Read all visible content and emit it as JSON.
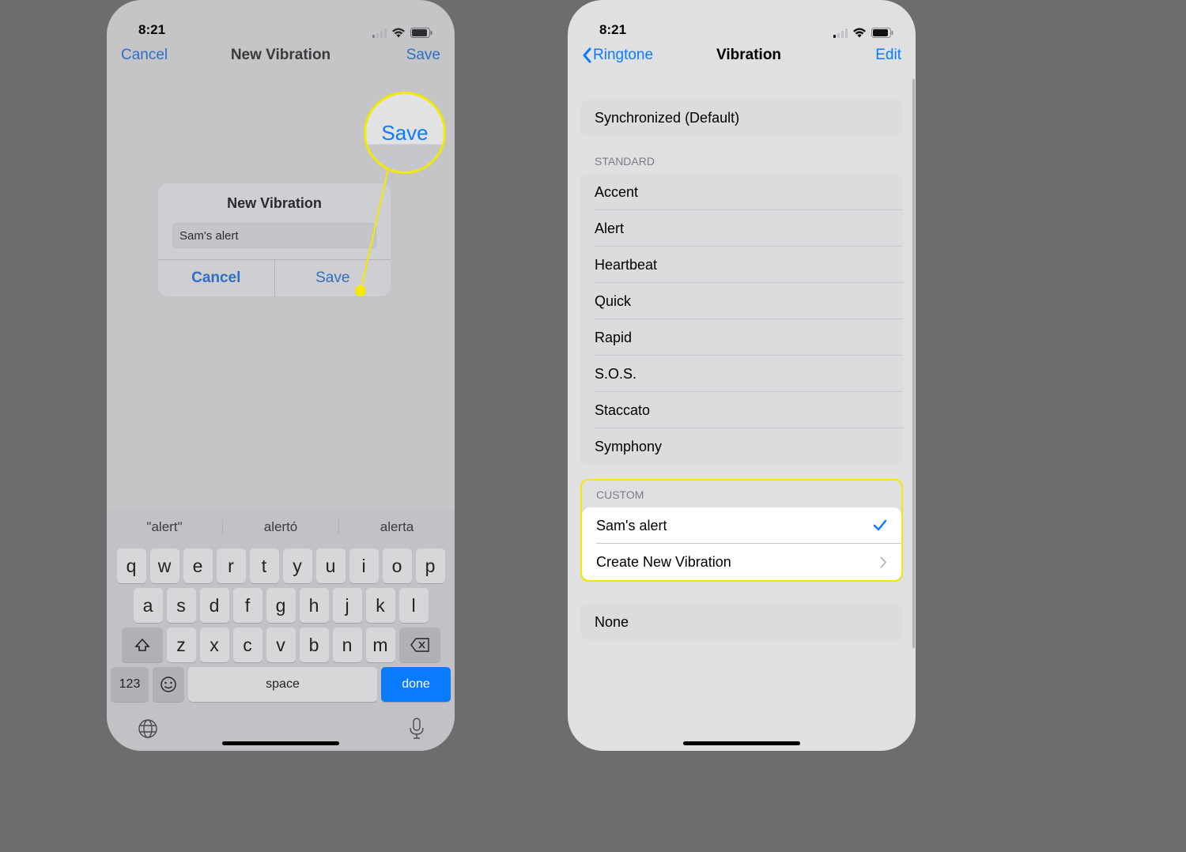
{
  "status": {
    "time": "8:21"
  },
  "left": {
    "nav": {
      "cancel": "Cancel",
      "title": "New Vibration",
      "save": "Save"
    },
    "dialog": {
      "title": "New Vibration",
      "input_value": "Sam's alert",
      "cancel": "Cancel",
      "save": "Save"
    },
    "magnifier": "Save",
    "keyboard": {
      "suggestions": [
        "\"alert\"",
        "alertó",
        "alerta"
      ],
      "row1": [
        "q",
        "w",
        "e",
        "r",
        "t",
        "y",
        "u",
        "i",
        "o",
        "p"
      ],
      "row2": [
        "a",
        "s",
        "d",
        "f",
        "g",
        "h",
        "j",
        "k",
        "l"
      ],
      "row3": [
        "z",
        "x",
        "c",
        "v",
        "b",
        "n",
        "m"
      ],
      "numbers": "123",
      "space": "space",
      "done": "done"
    }
  },
  "right": {
    "nav": {
      "back": "Ringtone",
      "title": "Vibration",
      "edit": "Edit"
    },
    "synced": "Synchronized (Default)",
    "standard_header": "STANDARD",
    "standard": [
      "Accent",
      "Alert",
      "Heartbeat",
      "Quick",
      "Rapid",
      "S.O.S.",
      "Staccato",
      "Symphony"
    ],
    "custom_header": "CUSTOM",
    "custom_items": {
      "sams_alert": "Sam's alert",
      "create_new": "Create New Vibration"
    },
    "none": "None"
  }
}
